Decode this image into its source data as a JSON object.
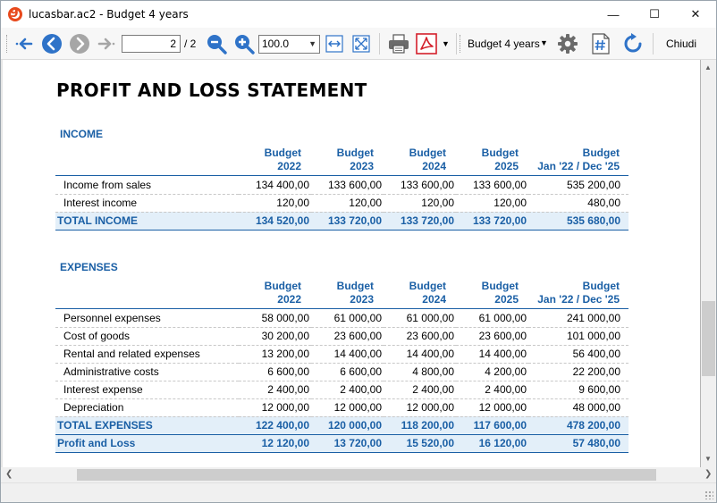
{
  "window": {
    "title": "lucasbar.ac2 - Budget 4 years",
    "minimize_glyph": "—",
    "maximize_glyph": "☐",
    "close_glyph": "✕"
  },
  "toolbar": {
    "page_current": "2",
    "page_total": "/ 2",
    "zoom_value": "100.0",
    "budget_selector": "Budget 4 years",
    "close_label": "Chiudi",
    "icons": [
      "first-page-icon",
      "previous-page-icon",
      "next-page-icon",
      "last-page-icon",
      "zoom-out-icon",
      "zoom-in-icon",
      "fit-width-icon",
      "fit-page-icon",
      "print-icon",
      "pdf-icon",
      "settings-icon",
      "hash-icon",
      "refresh-icon"
    ],
    "accent_blue": "#2f73c8",
    "pdf_red": "#d4202b"
  },
  "report": {
    "title": "PROFIT AND LOSS STATEMENT",
    "accent_color": "#1a5fa5",
    "total_row_bg": "#e3eff9",
    "columns": [
      {
        "l1": "Budget",
        "l2": "2022"
      },
      {
        "l1": "Budget",
        "l2": "2023"
      },
      {
        "l1": "Budget",
        "l2": "2024"
      },
      {
        "l1": "Budget",
        "l2": "2025"
      },
      {
        "l1": "Budget",
        "l2": "Jan '22 / Dec '25"
      }
    ],
    "income": {
      "label": "INCOME",
      "rows": [
        {
          "name": "Income from sales",
          "v": [
            "134 400,00",
            "133 600,00",
            "133 600,00",
            "133 600,00",
            "535 200,00"
          ]
        },
        {
          "name": "Interest income",
          "v": [
            "120,00",
            "120,00",
            "120,00",
            "120,00",
            "480,00"
          ]
        }
      ],
      "total": {
        "name": "TOTAL INCOME",
        "v": [
          "134 520,00",
          "133 720,00",
          "133 720,00",
          "133 720,00",
          "535 680,00"
        ]
      }
    },
    "expenses": {
      "label": "EXPENSES",
      "rows": [
        {
          "name": "Personnel expenses",
          "v": [
            "58 000,00",
            "61 000,00",
            "61 000,00",
            "61 000,00",
            "241 000,00"
          ]
        },
        {
          "name": "Cost of goods",
          "v": [
            "30 200,00",
            "23 600,00",
            "23 600,00",
            "23 600,00",
            "101 000,00"
          ]
        },
        {
          "name": "Rental and related expenses",
          "v": [
            "13 200,00",
            "14 400,00",
            "14 400,00",
            "14 400,00",
            "56 400,00"
          ]
        },
        {
          "name": "Administrative costs",
          "v": [
            "6 600,00",
            "6 600,00",
            "4 800,00",
            "4 200,00",
            "22 200,00"
          ]
        },
        {
          "name": "Interest expense",
          "v": [
            "2 400,00",
            "2 400,00",
            "2 400,00",
            "2 400,00",
            "9 600,00"
          ]
        },
        {
          "name": "Depreciation",
          "v": [
            "12 000,00",
            "12 000,00",
            "12 000,00",
            "12 000,00",
            "48 000,00"
          ]
        }
      ],
      "total": {
        "name": "TOTAL EXPENSES",
        "v": [
          "122 400,00",
          "120 000,00",
          "118 200,00",
          "117 600,00",
          "478 200,00"
        ]
      },
      "profit": {
        "name": "Profit and Loss",
        "v": [
          "12 120,00",
          "13 720,00",
          "15 520,00",
          "16 120,00",
          "57 480,00"
        ]
      }
    }
  }
}
